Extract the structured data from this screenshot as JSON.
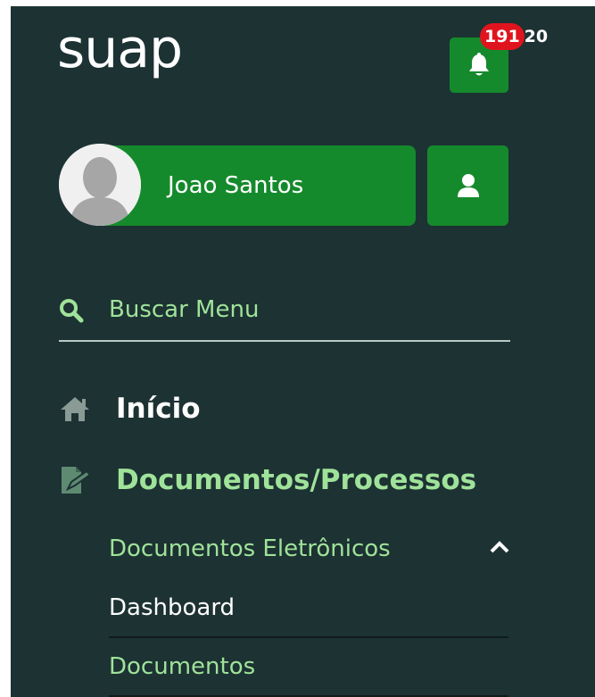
{
  "app": {
    "logo_text": "suap"
  },
  "notifications": {
    "count_highlight": "191",
    "count_rest": "20",
    "icon": "bell-icon"
  },
  "user": {
    "name": "Joao Santos",
    "avatar_icon": "user-silhouette",
    "profile_icon": "user-icon"
  },
  "search": {
    "placeholder": "Buscar Menu",
    "icon": "search-icon"
  },
  "menu": {
    "home": {
      "label": "Início",
      "icon": "home-icon"
    },
    "documents": {
      "label": "Documentos/Processos",
      "icon": "document-edit-icon",
      "submenu": {
        "label": "Documentos Eletrônicos",
        "state_icon": "chevron-up-icon",
        "items": [
          {
            "label": "Dashboard"
          },
          {
            "label": "Documentos"
          }
        ]
      }
    }
  },
  "colors": {
    "sidebar_bg": "#1d3233",
    "brand_green": "#158a2c",
    "accent_light_green": "#9fe39a",
    "badge_red": "#e0141e"
  }
}
